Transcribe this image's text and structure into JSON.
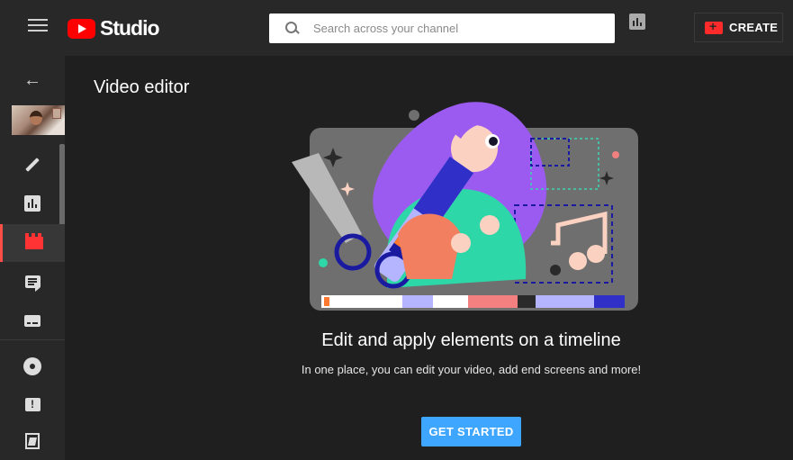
{
  "header": {
    "app_name": "Studio",
    "search": {
      "placeholder": "Search across your channel",
      "value": ""
    },
    "create_label": "CREATE"
  },
  "sidebar": {
    "items": [
      {
        "name": "back",
        "icon": "arrow-back-icon"
      },
      {
        "name": "video-thumbnail",
        "icon": "thumbnail"
      },
      {
        "name": "details",
        "icon": "pencil-icon"
      },
      {
        "name": "analytics",
        "icon": "analytics-icon"
      },
      {
        "name": "editor",
        "icon": "clapperboard-icon",
        "active": true
      },
      {
        "name": "comments",
        "icon": "comment-icon"
      },
      {
        "name": "subtitles",
        "icon": "subtitles-icon"
      },
      {
        "name": "settings",
        "icon": "gear-icon"
      },
      {
        "name": "feedback",
        "icon": "feedback-icon"
      },
      {
        "name": "creator-studio-classic",
        "icon": "creator-studio-icon"
      }
    ]
  },
  "main": {
    "title": "Video editor",
    "headline": "Edit and apply elements on a timeline",
    "subtext": "In one place, you can edit your video, add end screens and more!",
    "button_label": "GET STARTED"
  },
  "colors": {
    "brand_red": "#ff0000",
    "accent_blue": "#3ea6ff",
    "background": "#1f1f1f",
    "bar_background": "#282828"
  }
}
